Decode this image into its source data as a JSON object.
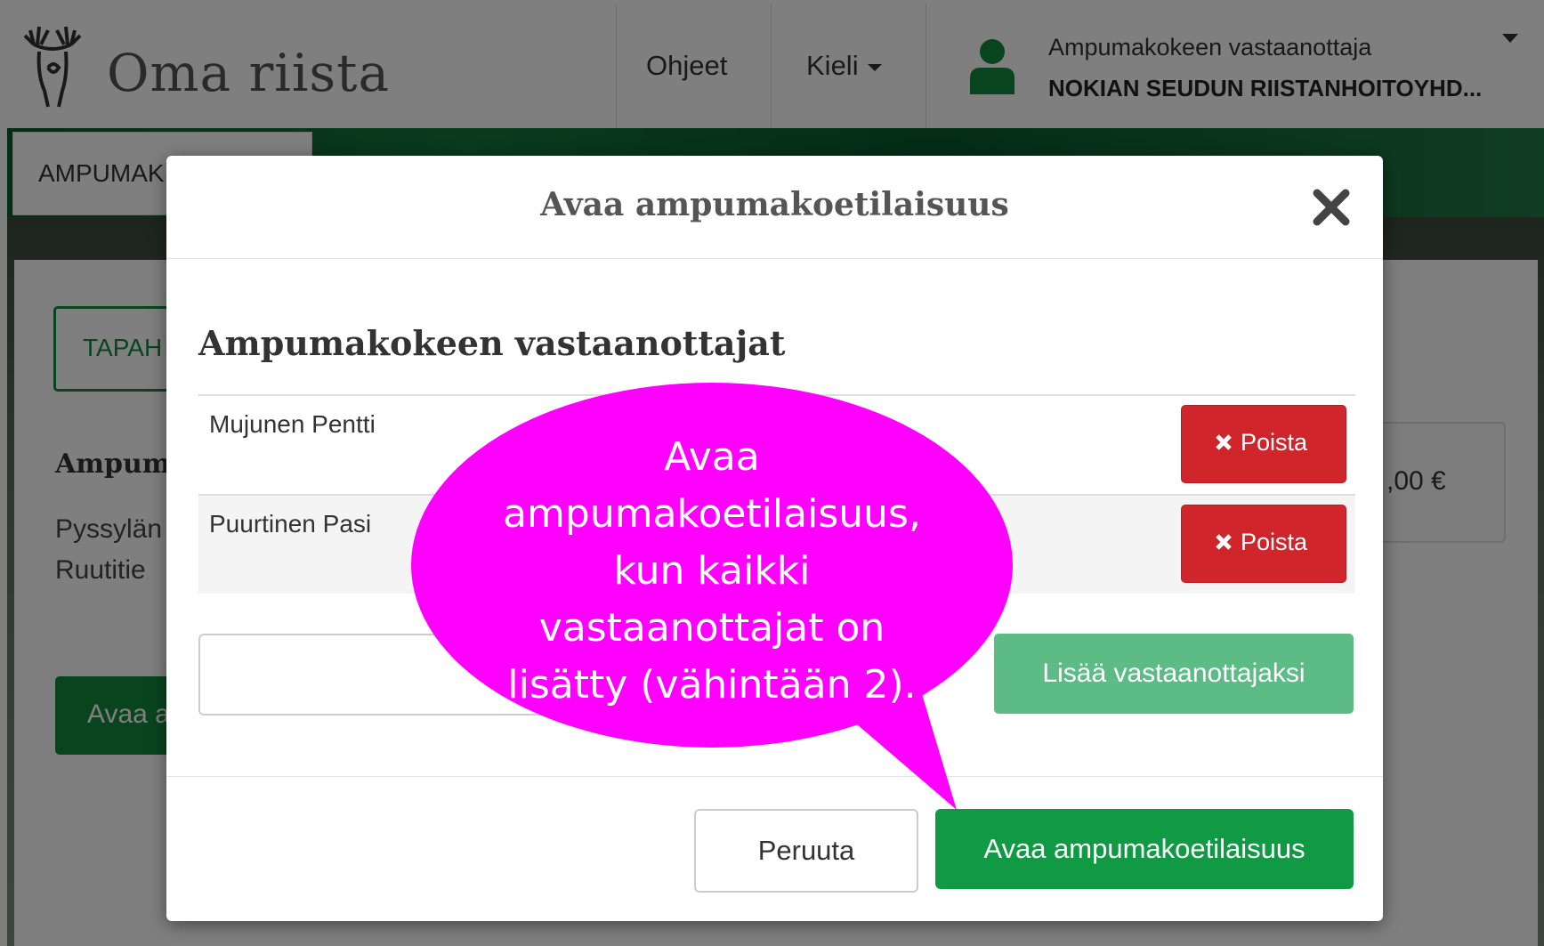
{
  "header": {
    "brand": "Oma riista",
    "nav_help": "Ohjeet",
    "nav_language": "Kieli",
    "user_role": "Ampumakokeen vastaanottaja",
    "user_org": "NOKIAN SEUDUN RIISTANHOITOYHD..."
  },
  "background": {
    "tab_label": "AMPUMAK",
    "tab_button": "TAPAH",
    "title": "Ampum",
    "address_line1": "Pyssylän",
    "address_line2": "Ruutitie",
    "price": ",00 €",
    "open_button": "Avaa a"
  },
  "modal": {
    "title": "Avaa ampumakoetilaisuus",
    "section_title": "Ampumakokeen vastaanottajat",
    "officials": [
      {
        "name": "Mujunen Pentti",
        "remove_label": "Poista"
      },
      {
        "name": "Puurtinen Pasi",
        "remove_label": "Poista"
      }
    ],
    "new_official_input": "",
    "add_button": "Lisää vastaanottajaksi",
    "cancel_button": "Peruuta",
    "confirm_button": "Avaa ampumakoetilaisuus"
  },
  "callout": {
    "lines": [
      "Avaa",
      "ampumakoetilaisuus,",
      "kun kaikki",
      "vastaanottajat on",
      "lisätty (vähintään 2)."
    ],
    "color": "#ff00ff"
  },
  "colors": {
    "green": "#0f9a43",
    "light_green": "#5dbb85",
    "danger": "#d0262b"
  }
}
